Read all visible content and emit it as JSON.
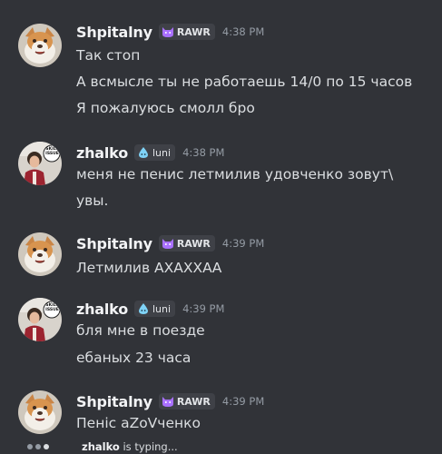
{
  "messages": [
    {
      "author": "Shpitalny",
      "tag": "RAWR",
      "tag_icon": "cat-face-icon",
      "time": "4:38 PM",
      "avatar": "dog-avatar",
      "lines": [
        "Так стоп",
        "А всмысле ты не работаешь 14/0 по 15 часов",
        "Я пожалуюсь смолл бро"
      ]
    },
    {
      "author": "zhalko",
      "tag": "luni",
      "tag_icon": "water-drop-icon",
      "time": "4:38 PM",
      "avatar": "skill-issue-avatar",
      "lines": [
        "меня не пенис летмилив удовченко зовут\\",
        "увы."
      ]
    },
    {
      "author": "Shpitalny",
      "tag": "RAWR",
      "tag_icon": "cat-face-icon",
      "time": "4:39 PM",
      "avatar": "dog-avatar",
      "lines": [
        "Летмилив АХАХХАА"
      ]
    },
    {
      "author": "zhalko",
      "tag": "luni",
      "tag_icon": "water-drop-icon",
      "time": "4:39 PM",
      "avatar": "skill-issue-avatar",
      "lines": [
        "бля мне в поезде",
        "ебаных 23 часа"
      ]
    },
    {
      "author": "Shpitalny",
      "tag": "RAWR",
      "tag_icon": "cat-face-icon",
      "time": "4:39 PM",
      "avatar": "dog-avatar",
      "lines": [
        "Пеніс аZoVченко"
      ]
    }
  ],
  "typing": {
    "user": "zhalko",
    "suffix": " is typing..."
  },
  "colors": {
    "background": "#313338",
    "username": "#f2f3f5",
    "message_text": "#dbdee1",
    "timestamp": "#949ba4",
    "tag_bg": "#3f4147",
    "rawr_icon": "#a970ff",
    "luni_icon": "#7fd3f7"
  },
  "avatar_labels": {
    "skill_issue": "SKILL ISSUE"
  }
}
